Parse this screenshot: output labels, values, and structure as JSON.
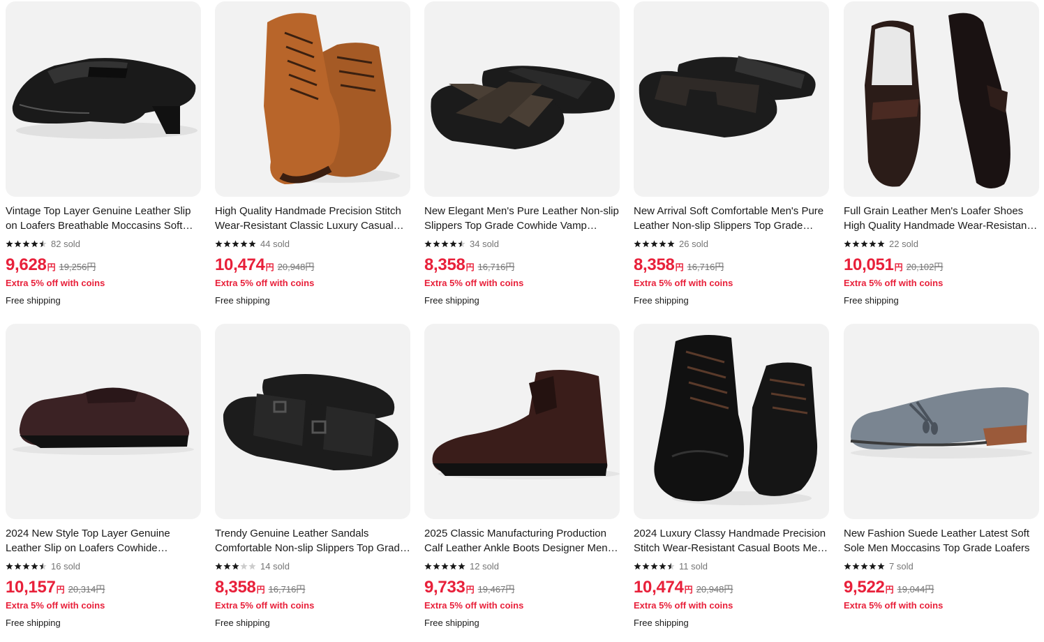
{
  "products": [
    {
      "title": "Vintage Top Layer Genuine Leather Slip on Loafers Breathable Moccasins Soft Sole",
      "rating": 4.5,
      "sold": "82 sold",
      "price": "9,628",
      "currency": "円",
      "original_price": "19,256円",
      "promo": "Extra 5% off with coins",
      "shipping": "Free shipping",
      "image": "black-penny-loafer"
    },
    {
      "title": "High Quality Handmade Precision Stitch Wear-Resistant Classic Luxury Casual Boots",
      "rating": 5,
      "sold": "44 sold",
      "price": "10,474",
      "currency": "円",
      "original_price": "20,948円",
      "promo": "Extra 5% off with coins",
      "shipping": "Free shipping",
      "image": "tan-lace-up-boots"
    },
    {
      "title": "New Elegant Men's Pure Leather Non-slip Slippers Top Grade Cowhide Vamp Sandals",
      "rating": 4.5,
      "sold": "34 sold",
      "price": "8,358",
      "currency": "円",
      "original_price": "16,716円",
      "promo": "Extra 5% off with coins",
      "shipping": "Free shipping",
      "image": "cross-strap-slides"
    },
    {
      "title": "New Arrival Soft Comfortable Men's Pure Leather Non-slip Slippers Top Grade Cowhide",
      "rating": 5,
      "sold": "26 sold",
      "price": "8,358",
      "currency": "円",
      "original_price": "16,716円",
      "promo": "Extra 5% off with coins",
      "shipping": "Free shipping",
      "image": "h-strap-slides"
    },
    {
      "title": "Full Grain Leather Men's Loafer Shoes High Quality Handmade Wear-Resistant Soles",
      "rating": 5,
      "sold": "22 sold",
      "price": "10,051",
      "currency": "円",
      "original_price": "20,102円",
      "promo": "Extra 5% off with coins",
      "shipping": "Free shipping",
      "image": "lug-sole-loafers"
    },
    {
      "title": "2024 New Style Top Layer Genuine Leather Slip on Loafers Cowhide Business Shoes",
      "rating": 4.5,
      "sold": "16 sold",
      "price": "10,157",
      "currency": "円",
      "original_price": "20,314円",
      "promo": "Extra 5% off with coins",
      "shipping": "Free shipping",
      "image": "brown-penny-loafer"
    },
    {
      "title": "Trendy Genuine Leather Sandals Comfortable Non-slip Slippers Top Grade Cowhide",
      "rating": 3,
      "sold": "14 sold",
      "price": "8,358",
      "currency": "円",
      "original_price": "16,716円",
      "promo": "Extra 5% off with coins",
      "shipping": "Free shipping",
      "image": "buckle-slides"
    },
    {
      "title": "2025 Classic Manufacturing Production Calf Leather Ankle Boots Designer Men Shoes",
      "rating": 5,
      "sold": "12 sold",
      "price": "9,733",
      "currency": "円",
      "original_price": "19,467円",
      "promo": "Extra 5% off with coins",
      "shipping": "Free shipping",
      "image": "chukka-boot"
    },
    {
      "title": "2024 Luxury Classy Handmade Precision Stitch Wear-Resistant Casual Boots Men Shoes",
      "rating": 4.5,
      "sold": "11 sold",
      "price": "10,474",
      "currency": "円",
      "original_price": "20,948円",
      "promo": "Extra 5% off with coins",
      "shipping": "Free shipping",
      "image": "black-lace-up-boots"
    },
    {
      "title": "New Fashion Suede Leather Latest Soft Sole Men Moccasins Top Grade Loafers",
      "rating": 5,
      "sold": "7 sold",
      "price": "9,522",
      "currency": "円",
      "original_price": "19,044円",
      "promo": "Extra 5% off with coins",
      "shipping": "",
      "image": "grey-suede-tassel-loafer"
    }
  ],
  "colors": {
    "accent": "#e8203a",
    "muted": "#757575",
    "star": "#191919",
    "star_empty": "#cccccc"
  }
}
